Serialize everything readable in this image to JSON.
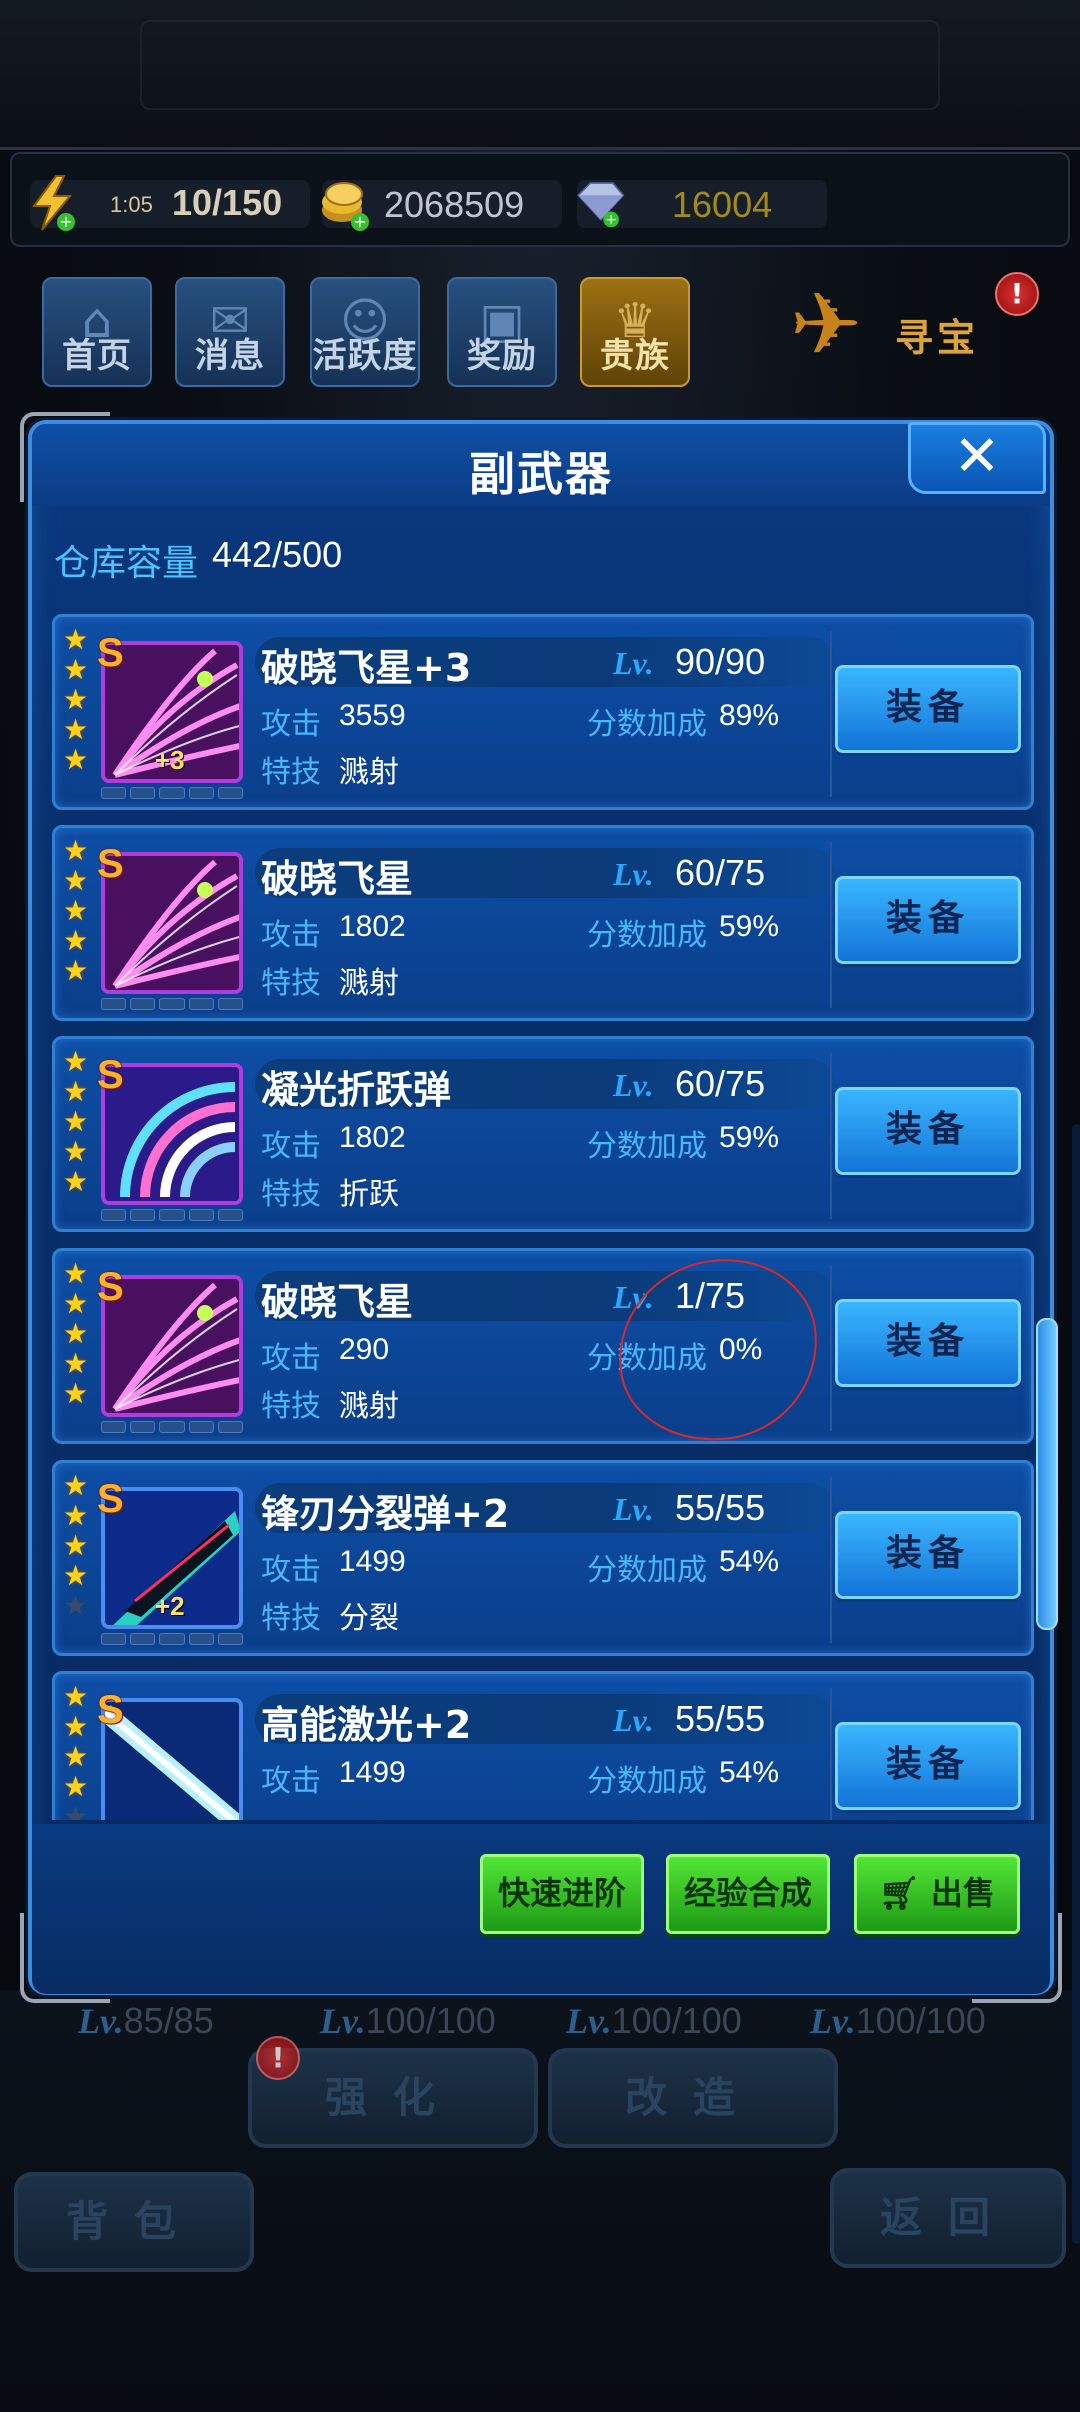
{
  "resources": {
    "energy_timer": "1:05",
    "energy": "10/150",
    "gold": "2068509",
    "gems": "16004"
  },
  "nav": [
    {
      "label": "首页",
      "icon": "home-icon"
    },
    {
      "label": "消息",
      "icon": "mail-icon"
    },
    {
      "label": "活跃度",
      "icon": "activity-icon"
    },
    {
      "label": "奖励",
      "icon": "gift-icon"
    },
    {
      "label": "贵族",
      "icon": "noble-icon"
    }
  ],
  "treasure": {
    "label": "寻宝",
    "badge": "!"
  },
  "panel": {
    "title": "副武器",
    "close": "✕",
    "capacity_label": "仓库容量",
    "capacity_value": "442/500"
  },
  "labels": {
    "lv": "Lv.",
    "attack": "攻击",
    "bonus": "分数加成",
    "skill": "特技",
    "equip": "装备"
  },
  "items": [
    {
      "name": "破晓飞星+3",
      "level": "90/90",
      "attack": "3559",
      "bonus": "89%",
      "skill": "溅射",
      "rank": "S",
      "stars": 5,
      "plus": "+3"
    },
    {
      "name": "破晓飞星",
      "level": "60/75",
      "attack": "1802",
      "bonus": "59%",
      "skill": "溅射",
      "rank": "S",
      "stars": 5,
      "plus": ""
    },
    {
      "name": "凝光折跃弹",
      "level": "60/75",
      "attack": "1802",
      "bonus": "59%",
      "skill": "折跃",
      "rank": "S",
      "stars": 5,
      "plus": ""
    },
    {
      "name": "破晓飞星",
      "level": "1/75",
      "attack": "290",
      "bonus": "0%",
      "skill": "溅射",
      "rank": "S",
      "stars": 5,
      "plus": ""
    },
    {
      "name": "锋刃分裂弹+2",
      "level": "55/55",
      "attack": "1499",
      "bonus": "54%",
      "skill": "分裂",
      "rank": "S",
      "stars": 4,
      "plus": "+2"
    },
    {
      "name": "高能激光+2",
      "level": "55/55",
      "attack": "1499",
      "bonus": "54%",
      "skill": "",
      "rank": "S",
      "stars": 4,
      "plus": ""
    }
  ],
  "actions": {
    "quick_advance": "快速进阶",
    "exp_merge": "经验合成",
    "sell": "出售"
  },
  "background": {
    "levels": [
      "85/85",
      "100/100",
      "100/100",
      "100/100"
    ],
    "strengthen": "强化",
    "modify": "改造",
    "bag": "背包",
    "back": "返回",
    "badge": "!"
  },
  "colors": {
    "panel": "#0a3a82",
    "accent": "#46b8ff",
    "equip_button": "#3ab6ff",
    "green_button": "#52e636",
    "star": "#ffd21a",
    "rank_s": "#ffb12a",
    "annotation": "#d8282c"
  }
}
